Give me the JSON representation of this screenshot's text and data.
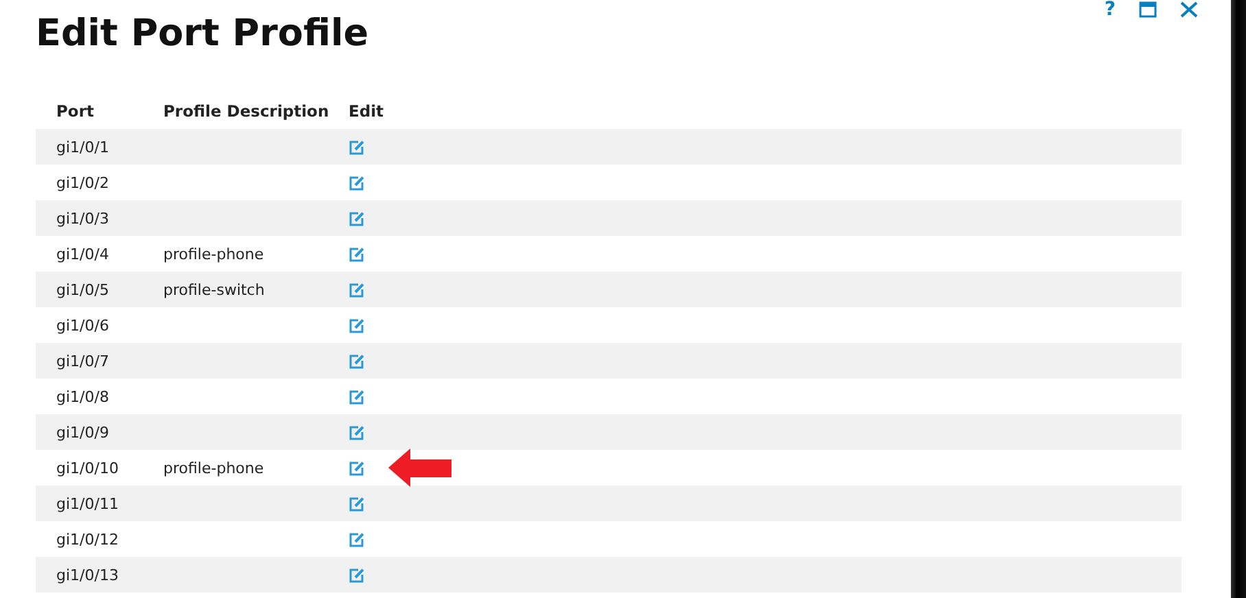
{
  "window": {
    "title": "Edit Port Profile",
    "help": "?"
  },
  "table": {
    "columns": [
      "Port",
      "Profile Description",
      "Edit"
    ],
    "rows": [
      {
        "port": "gi1/0/1",
        "description": "",
        "marked": false
      },
      {
        "port": "gi1/0/2",
        "description": "",
        "marked": false
      },
      {
        "port": "gi1/0/3",
        "description": "",
        "marked": false
      },
      {
        "port": "gi1/0/4",
        "description": "profile-phone",
        "marked": false
      },
      {
        "port": "gi1/0/5",
        "description": "profile-switch",
        "marked": false
      },
      {
        "port": "gi1/0/6",
        "description": "",
        "marked": false
      },
      {
        "port": "gi1/0/7",
        "description": "",
        "marked": false
      },
      {
        "port": "gi1/0/8",
        "description": "",
        "marked": false
      },
      {
        "port": "gi1/0/9",
        "description": "",
        "marked": false
      },
      {
        "port": "gi1/0/10",
        "description": "profile-phone",
        "marked": true
      },
      {
        "port": "gi1/0/11",
        "description": "",
        "marked": false
      },
      {
        "port": "gi1/0/12",
        "description": "",
        "marked": false
      },
      {
        "port": "gi1/0/13",
        "description": "",
        "marked": false
      }
    ]
  }
}
